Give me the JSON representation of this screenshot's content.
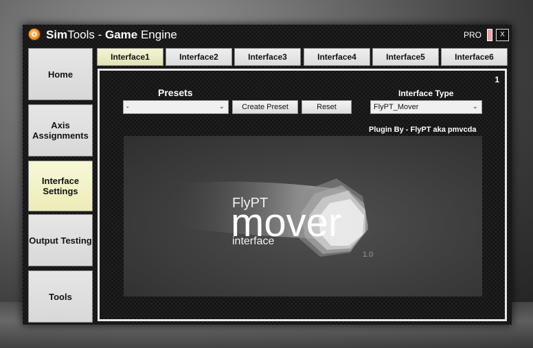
{
  "window": {
    "title_part1": "Sim",
    "title_part2": "Tools - ",
    "title_part3": "Game",
    "title_part4": " Engine",
    "pro_label": "PRO",
    "close_label": "X"
  },
  "sidebar": {
    "items": [
      {
        "label": "Home"
      },
      {
        "label": "Axis Assignments"
      },
      {
        "label": "Interface Settings",
        "active": true
      },
      {
        "label": "Output Testing"
      },
      {
        "label": "Tools"
      }
    ]
  },
  "tabs": [
    {
      "label": "Interface1",
      "active": true
    },
    {
      "label": "Interface2"
    },
    {
      "label": "Interface3"
    },
    {
      "label": "Interface4"
    },
    {
      "label": "Interface5"
    },
    {
      "label": "Interface6"
    }
  ],
  "panel": {
    "number": "1",
    "presets_label": "Presets",
    "presets_value": "-",
    "create_preset_label": "Create Preset",
    "reset_label": "Reset",
    "interface_type_label": "Interface Type",
    "interface_type_value": "FlyPT_Mover",
    "plugin_by": "Plugin By - FlyPT aka pmvcda",
    "logo": {
      "brand": "FlyPT",
      "word": "mover",
      "sub": "interface",
      "version": "1.0"
    }
  },
  "colors": {
    "active_button": "#ececb8",
    "button": "#dcdcdc",
    "panel_border": "#e8e8e8",
    "app_icon": "#f08a1a"
  }
}
